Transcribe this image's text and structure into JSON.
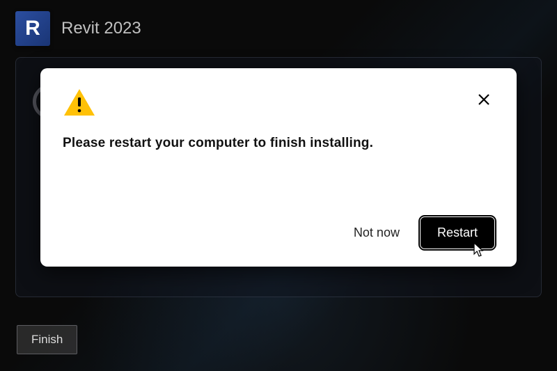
{
  "header": {
    "logo_letter": "R",
    "title": "Revit 2023"
  },
  "dialog": {
    "message": "Please restart your computer to finish installing.",
    "not_now_label": "Not now",
    "restart_label": "Restart"
  },
  "footer": {
    "finish_label": "Finish"
  },
  "colors": {
    "warning_fill": "#ffc107",
    "restart_bg": "#000000",
    "restart_fg": "#ffffff"
  }
}
